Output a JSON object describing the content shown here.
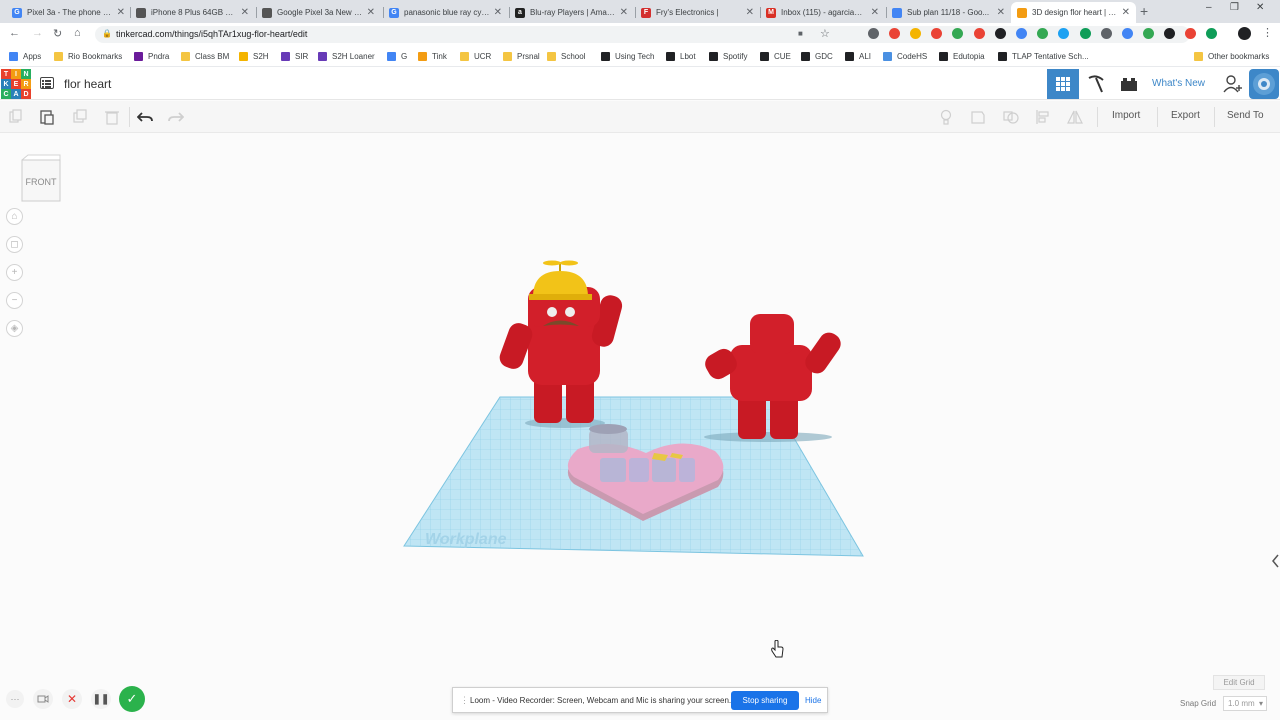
{
  "browser": {
    "tabs": [
      {
        "title": "Pixel 3a - The phone th...",
        "icon": "google-icon",
        "color": "#4285f4",
        "glyph": "G"
      },
      {
        "title": "iPhone 8 Plus 64GB Sp...",
        "icon": "apple-icon",
        "color": "#555555",
        "glyph": ""
      },
      {
        "title": "Google Pixel 3a New Lo...",
        "icon": "dash-icon",
        "color": "#555555",
        "glyph": ""
      },
      {
        "title": "panasonic blue ray cyb...",
        "icon": "google-icon",
        "color": "#4285f4",
        "glyph": "G"
      },
      {
        "title": "Blu-ray Players | Amazo...",
        "icon": "amazon-icon",
        "color": "#222222",
        "glyph": "a"
      },
      {
        "title": "Fry's Electronics |",
        "icon": "frys-icon",
        "color": "#d32f2f",
        "glyph": "F"
      },
      {
        "title": "Inbox (115) - agarcia@...",
        "icon": "gmail-icon",
        "color": "#d93025",
        "glyph": "M"
      },
      {
        "title": "Sub plan 11/18 - Goo...",
        "icon": "docs-icon",
        "color": "#4285f4",
        "glyph": ""
      },
      {
        "title": "3D design flor heart | T...",
        "icon": "tinkercad-icon",
        "color": "#f39c12",
        "glyph": ""
      }
    ],
    "url": "tinkercad.com/things/i5qhTAr1xug-flor-heart/edit",
    "bookmarks": [
      {
        "label": "Apps",
        "color": "#4285f4"
      },
      {
        "label": "Rio Bookmarks",
        "color": "#f4c542"
      },
      {
        "label": "Pndra",
        "color": "#6a1b9a"
      },
      {
        "label": "Class BM",
        "color": "#f4c542"
      },
      {
        "label": "S2H",
        "color": "#f4b400"
      },
      {
        "label": "SIR",
        "color": "#673ab7"
      },
      {
        "label": "S2H Loaner",
        "color": "#673ab7"
      },
      {
        "label": "G",
        "color": "#4285f4"
      },
      {
        "label": "Tink",
        "color": "#f39c12"
      },
      {
        "label": "UCR",
        "color": "#f4c542"
      },
      {
        "label": "Prsnal",
        "color": "#f4c542"
      },
      {
        "label": "School",
        "color": "#f4c542"
      },
      {
        "label": "Using Tech",
        "color": "#202124"
      },
      {
        "label": "Lbot",
        "color": "#202124"
      },
      {
        "label": "Spotify",
        "color": "#202124"
      },
      {
        "label": "CUE",
        "color": "#202124"
      },
      {
        "label": "GDC",
        "color": "#202124"
      },
      {
        "label": "ALI",
        "color": "#202124"
      },
      {
        "label": "CodeHS",
        "color": "#4a90e2"
      },
      {
        "label": "Edutopia",
        "color": "#202124"
      },
      {
        "label": "TLAP Tentative Sch...",
        "color": "#202124"
      },
      {
        "label": "Other bookmarks",
        "color": "#f4c542"
      }
    ]
  },
  "tinkercad": {
    "logo_letters": [
      "T",
      "I",
      "N",
      "K",
      "E",
      "R",
      "C",
      "A",
      "D"
    ],
    "logo_colors": [
      "#e8412c",
      "#f39c12",
      "#27ae60",
      "#2980b9",
      "#e8412c",
      "#f39c12",
      "#27ae60",
      "#2980b9",
      "#e8412c"
    ],
    "design_title": "flor heart",
    "whats_new": "What's New",
    "toolbar": {
      "import": "Import",
      "export": "Export",
      "send_to": "Send To"
    },
    "viewcube_label": "FRONT",
    "workplane_label": "Workplane",
    "edit_grid": "Edit Grid",
    "snap_grid_label": "Snap Grid",
    "snap_grid_value": "1.0 mm"
  },
  "loom": {
    "message": "Loom - Video Recorder: Screen, Webcam and Mic is sharing your screen.",
    "stop_label": "Stop sharing",
    "hide_label": "Hide"
  }
}
